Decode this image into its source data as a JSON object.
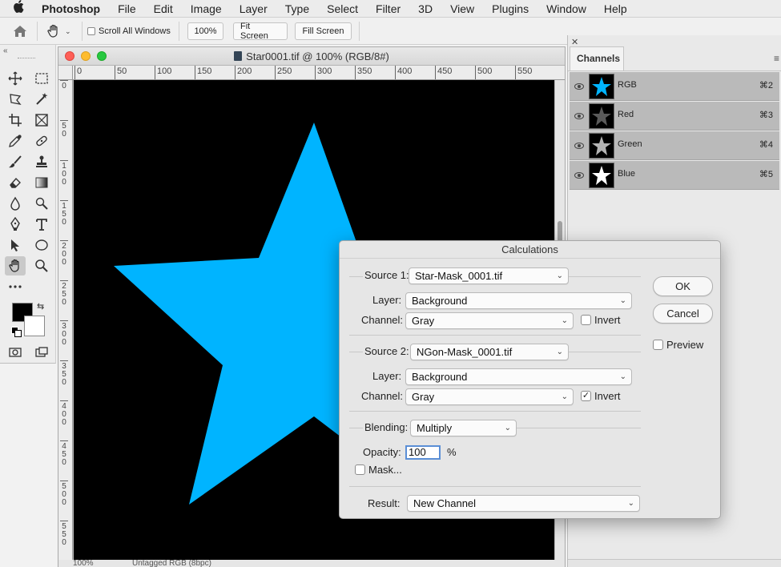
{
  "menubar": {
    "app": "Photoshop",
    "items": [
      "File",
      "Edit",
      "Image",
      "Layer",
      "Type",
      "Select",
      "Filter",
      "3D",
      "View",
      "Plugins",
      "Window",
      "Help"
    ]
  },
  "options_bar": {
    "scroll_all_windows": "Scroll All Windows",
    "zoom_100": "100%",
    "fit_screen": "Fit Screen",
    "fill_screen": "Fill Screen"
  },
  "document": {
    "title": "Star0001.tif @ 100% (RGB/8#)",
    "ruler_h": [
      "0",
      "50",
      "100",
      "150",
      "200",
      "250",
      "300",
      "350",
      "400",
      "450",
      "500",
      "550"
    ],
    "ruler_v": [
      "0",
      "5\n0",
      "1\n0\n0",
      "1\n5\n0",
      "2\n0\n0",
      "2\n5\n0",
      "3\n0\n0",
      "3\n5\n0",
      "4\n0\n0",
      "4\n5\n0",
      "5\n0\n0",
      "5\n5\n0"
    ],
    "status_zoom": "100%",
    "status_profile": "Untagged RGB (8bpc)",
    "star_color": "#00b4ff"
  },
  "channels": {
    "tab": "Channels",
    "rows": [
      {
        "name": "RGB",
        "key": "⌘2",
        "thumb_color": "#00b4ff"
      },
      {
        "name": "Red",
        "key": "⌘3",
        "thumb_color": "#5a5a5a"
      },
      {
        "name": "Green",
        "key": "⌘4",
        "thumb_color": "#b4b4b4"
      },
      {
        "name": "Blue",
        "key": "⌘5",
        "thumb_color": "#ffffff"
      }
    ]
  },
  "dialog": {
    "title": "Calculations",
    "source1_label": "Source 1:",
    "source1_value": "Star-Mask_0001.tif",
    "layer_label": "Layer:",
    "source1_layer": "Background",
    "channel_label": "Channel:",
    "source1_channel": "Gray",
    "invert_label": "Invert",
    "source1_invert": false,
    "source2_label": "Source 2:",
    "source2_value": "NGon-Mask_0001.tif",
    "source2_layer": "Background",
    "source2_channel": "Gray",
    "source2_invert": true,
    "blending_label": "Blending:",
    "blending_value": "Multiply",
    "opacity_label": "Opacity:",
    "opacity_value": "100",
    "percent": "%",
    "mask_label": "Mask...",
    "result_label": "Result:",
    "result_value": "New Channel",
    "ok": "OK",
    "cancel": "Cancel",
    "preview": "Preview"
  }
}
